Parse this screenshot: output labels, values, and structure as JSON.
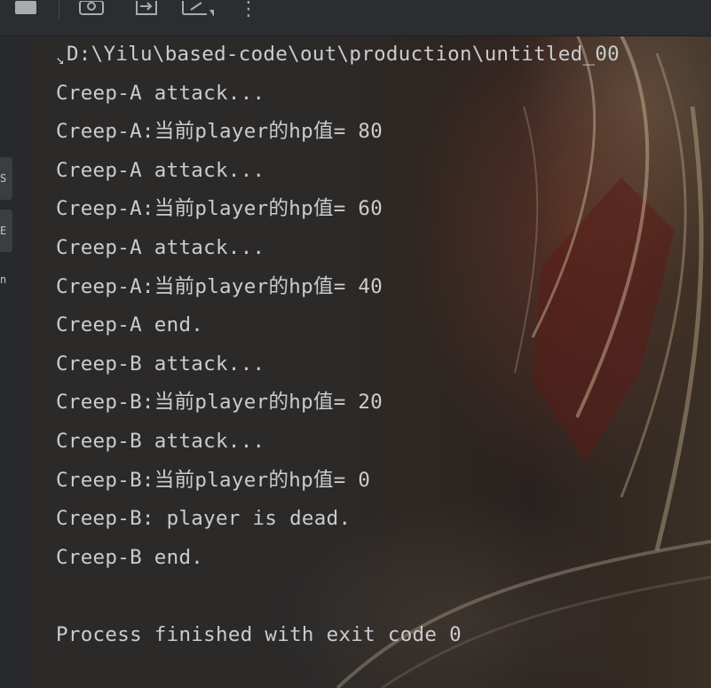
{
  "toolbar": {
    "icons": [
      "stop-icon",
      "camera-icon",
      "export-icon",
      "settings-icon",
      "more-icon"
    ],
    "more_glyph": "⋮"
  },
  "gutter": {
    "tabs": [
      "S",
      "E",
      "n"
    ]
  },
  "console": {
    "command_line": "D:\\Yilu\\based-code\\out\\production\\untitled_00",
    "lines": [
      "Creep-A attack...",
      "Creep-A:当前player的hp值= 80",
      "Creep-A attack...",
      "Creep-A:当前player的hp值= 60",
      "Creep-A attack...",
      "Creep-A:当前player的hp值= 40",
      "Creep-A end.",
      "Creep-B attack...",
      "Creep-B:当前player的hp值= 20",
      "Creep-B attack...",
      "Creep-B:当前player的hp值= 0",
      "Creep-B: player is dead.",
      "Creep-B end.",
      "",
      "Process finished with exit code 0"
    ]
  },
  "colors": {
    "console_text": "#c9ccd1",
    "toolbar_bg": "#2b2d30",
    "gutter_bg": "#27292c"
  }
}
